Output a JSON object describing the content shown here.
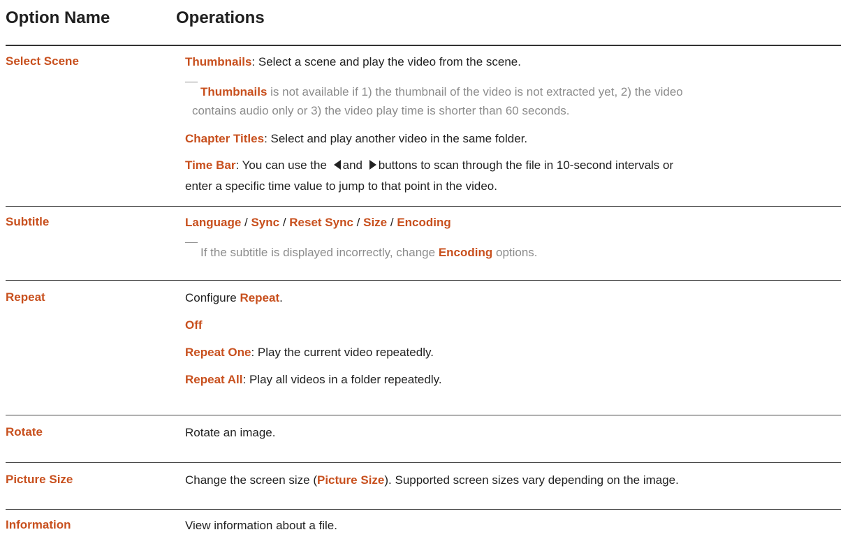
{
  "header": {
    "col_name": "Option Name",
    "col_ops": "Operations"
  },
  "rows": {
    "select_scene": {
      "name": "Select Scene",
      "thumbnails_kw": "Thumbnails",
      "thumbnails_text": ": Select a scene and play the video from the scene.",
      "note_kw": "Thumbnails",
      "note_text_1": " is not available if 1) the thumbnail of the video is not extracted yet, 2) the video",
      "note_text_2": "contains audio only or 3) the video play time is shorter than 60 seconds.",
      "chapter_kw": "Chapter Titles",
      "chapter_text": ": Select and play another video in the same folder.",
      "timebar_kw": "Time Bar",
      "timebar_text_a": ": You can use the ",
      "timebar_text_b": "and ",
      "timebar_text_c": "buttons to scan through the file in 10-second intervals or",
      "timebar_text_2": "enter a specific time value to jump to that point in the video."
    },
    "subtitle": {
      "name": "Subtitle",
      "opt_language": "Language",
      "opt_sync": "Sync",
      "opt_reset_sync": "Reset Sync",
      "opt_size": "Size",
      "opt_encoding": "Encoding",
      "sep": " / ",
      "note_text": "If the subtitle is displayed incorrectly, change ",
      "note_kw": "Encoding",
      "note_text_end": " options."
    },
    "repeat": {
      "name": "Repeat",
      "configure_text": "Configure ",
      "configure_kw": "Repeat",
      "configure_end": ".",
      "off_kw": "Off",
      "one_kw": "Repeat One",
      "one_text": ": Play the current video repeatedly.",
      "all_kw": "Repeat All",
      "all_text": ": Play all videos in a folder repeatedly."
    },
    "rotate": {
      "name": "Rotate",
      "text": "Rotate an image."
    },
    "picture_size": {
      "name": "Picture Size",
      "text_a": "Change the screen size (",
      "kw": "Picture Size",
      "text_b": "). Supported screen sizes vary depending on the image."
    },
    "information": {
      "name": "Information",
      "text": "View information about a file."
    }
  },
  "icons": {
    "left_arrow": "left-triangle-icon",
    "right_arrow": "right-triangle-icon"
  },
  "colors": {
    "accent": "#c8501e",
    "note": "#8c8c8c",
    "text": "#222222"
  }
}
